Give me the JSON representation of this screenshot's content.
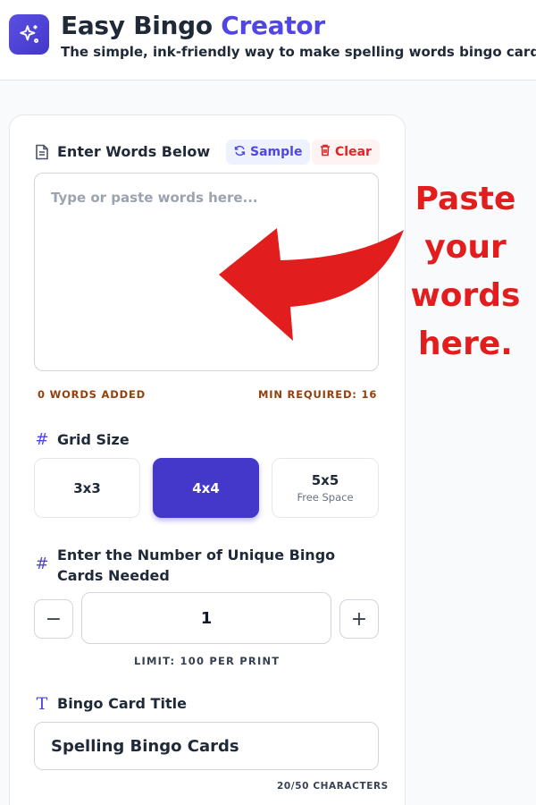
{
  "header": {
    "logo_icon": "sparkles-icon",
    "title_main": "Easy Bingo ",
    "title_accent": "Creator",
    "subtitle": "The simple, ink-friendly way to make spelling words bingo cards."
  },
  "words": {
    "label": "Enter Words Below",
    "icon": "document-icon",
    "sample_label": "Sample",
    "clear_label": "Clear",
    "placeholder": "Type or paste words here...",
    "value": "",
    "count_text": "0 WORDS ADDED",
    "min_text": "MIN REQUIRED: 16"
  },
  "grid": {
    "label": "Grid Size",
    "options": [
      {
        "label": "3x3",
        "sub": ""
      },
      {
        "label": "4x4",
        "sub": ""
      },
      {
        "label": "5x5",
        "sub": "Free Space"
      }
    ],
    "selected": "4x4"
  },
  "cards": {
    "label": "Enter the Number of Unique Bingo Cards Needed",
    "value": "1",
    "minus": "−",
    "plus": "+",
    "limit_text": "LIMIT: 100 PER PRINT"
  },
  "card_title": {
    "label": "Bingo Card Title",
    "value": "Spelling Bingo Cards",
    "char_count": "20/50 CHARACTERS"
  },
  "annotation": {
    "text": "Paste your words here.",
    "color": "#e11d1d"
  },
  "colors": {
    "accent": "#4f46e5",
    "selected": "#4338ca",
    "warning_text": "#92400e",
    "danger": "#dc2626"
  }
}
